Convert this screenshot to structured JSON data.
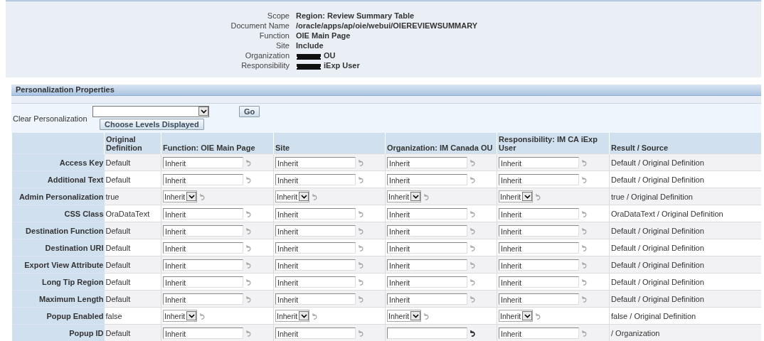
{
  "context": {
    "fields": [
      {
        "label": "Scope",
        "value": "Region: Review Summary Table",
        "redacted": false
      },
      {
        "label": "Document Name",
        "value": "/oracle/apps/ap/oie/webui/OIEREVIEWSUMMARY",
        "redacted": false
      },
      {
        "label": "Function",
        "value": "OIE Main Page",
        "redacted": false
      },
      {
        "label": "Site",
        "value": "Include",
        "redacted": false
      },
      {
        "label": "Organization",
        "value": "OU",
        "redacted": true
      },
      {
        "label": "Responsibility",
        "value": "iExp User",
        "redacted": true
      }
    ]
  },
  "properties": {
    "title": "Personalization Properties",
    "clear_label": "Clear Personalization",
    "go_button": "Go",
    "choose_button": "Choose Levels Displayed",
    "columns": [
      "",
      "Original Definition",
      "Function: OIE Main Page",
      "Site",
      "Organization: IM Canada OU",
      "Responsibility: IM CA iExp User",
      "Result / Source"
    ],
    "rows": [
      {
        "label": "Access Key",
        "original": "Default",
        "function": {
          "kind": "text",
          "value": "Inherit",
          "reset_enabled": false
        },
        "site": {
          "kind": "text",
          "value": "Inherit",
          "reset_enabled": false
        },
        "organization": {
          "kind": "text",
          "value": "Inherit",
          "reset_enabled": false
        },
        "responsibility": {
          "kind": "text",
          "value": "Inherit",
          "reset_enabled": false
        },
        "result": "Default / Original Definition"
      },
      {
        "label": "Additional Text",
        "original": "Default",
        "function": {
          "kind": "text",
          "value": "Inherit",
          "reset_enabled": false
        },
        "site": {
          "kind": "text",
          "value": "Inherit",
          "reset_enabled": false
        },
        "organization": {
          "kind": "text",
          "value": "Inherit",
          "reset_enabled": false
        },
        "responsibility": {
          "kind": "text",
          "value": "Inherit",
          "reset_enabled": false
        },
        "result": "Default / Original Definition"
      },
      {
        "label": "Admin Personalization",
        "original": "true",
        "function": {
          "kind": "select",
          "value": "Inherit",
          "reset_enabled": false
        },
        "site": {
          "kind": "select",
          "value": "Inherit",
          "reset_enabled": false
        },
        "organization": {
          "kind": "select",
          "value": "Inherit",
          "reset_enabled": false
        },
        "responsibility": {
          "kind": "select",
          "value": "Inherit",
          "reset_enabled": false
        },
        "result": "true / Original Definition"
      },
      {
        "label": "CSS Class",
        "original": "OraDataText",
        "function": {
          "kind": "text",
          "value": "Inherit",
          "reset_enabled": false
        },
        "site": {
          "kind": "text",
          "value": "Inherit",
          "reset_enabled": false
        },
        "organization": {
          "kind": "text",
          "value": "Inherit",
          "reset_enabled": false
        },
        "responsibility": {
          "kind": "text",
          "value": "Inherit",
          "reset_enabled": false
        },
        "result": "OraDataText / Original Definition"
      },
      {
        "label": "Destination Function",
        "original": "Default",
        "function": {
          "kind": "text",
          "value": "Inherit",
          "reset_enabled": false
        },
        "site": {
          "kind": "text",
          "value": "Inherit",
          "reset_enabled": false
        },
        "organization": {
          "kind": "text",
          "value": "Inherit",
          "reset_enabled": false
        },
        "responsibility": {
          "kind": "text",
          "value": "Inherit",
          "reset_enabled": false
        },
        "result": "Default / Original Definition"
      },
      {
        "label": "Destination URI",
        "original": "Default",
        "function": {
          "kind": "text",
          "value": "Inherit",
          "reset_enabled": false
        },
        "site": {
          "kind": "text",
          "value": "Inherit",
          "reset_enabled": false
        },
        "organization": {
          "kind": "text",
          "value": "Inherit",
          "reset_enabled": false
        },
        "responsibility": {
          "kind": "text",
          "value": "Inherit",
          "reset_enabled": false
        },
        "result": "Default / Original Definition"
      },
      {
        "label": "Export View Attribute",
        "original": "Default",
        "function": {
          "kind": "text",
          "value": "Inherit",
          "reset_enabled": false
        },
        "site": {
          "kind": "text",
          "value": "Inherit",
          "reset_enabled": false
        },
        "organization": {
          "kind": "text",
          "value": "Inherit",
          "reset_enabled": false
        },
        "responsibility": {
          "kind": "text",
          "value": "Inherit",
          "reset_enabled": false
        },
        "result": "Default / Original Definition"
      },
      {
        "label": "Long Tip Region",
        "original": "Default",
        "function": {
          "kind": "text",
          "value": "Inherit",
          "reset_enabled": false
        },
        "site": {
          "kind": "text",
          "value": "Inherit",
          "reset_enabled": false
        },
        "organization": {
          "kind": "text",
          "value": "Inherit",
          "reset_enabled": false
        },
        "responsibility": {
          "kind": "text",
          "value": "Inherit",
          "reset_enabled": false
        },
        "result": "Default / Original Definition"
      },
      {
        "label": "Maximum Length",
        "original": "Default",
        "function": {
          "kind": "text",
          "value": "Inherit",
          "reset_enabled": false
        },
        "site": {
          "kind": "text",
          "value": "Inherit",
          "reset_enabled": false
        },
        "organization": {
          "kind": "text",
          "value": "Inherit",
          "reset_enabled": false
        },
        "responsibility": {
          "kind": "text",
          "value": "Inherit",
          "reset_enabled": false
        },
        "result": "Default / Original Definition"
      },
      {
        "label": "Popup Enabled",
        "original": "false",
        "function": {
          "kind": "select",
          "value": "Inherit",
          "reset_enabled": false
        },
        "site": {
          "kind": "select",
          "value": "Inherit",
          "reset_enabled": false
        },
        "organization": {
          "kind": "select",
          "value": "Inherit",
          "reset_enabled": false
        },
        "responsibility": {
          "kind": "select",
          "value": "Inherit",
          "reset_enabled": false
        },
        "result": "false / Original Definition"
      },
      {
        "label": "Popup ID",
        "original": "Default",
        "function": {
          "kind": "text",
          "value": "Inherit",
          "reset_enabled": false
        },
        "site": {
          "kind": "text",
          "value": "Inherit",
          "reset_enabled": false
        },
        "organization": {
          "kind": "text",
          "reset_enabled": true
        },
        "responsibility": {
          "kind": "text",
          "value": "Inherit",
          "reset_enabled": false
        },
        "result": "/ Organization"
      }
    ]
  }
}
